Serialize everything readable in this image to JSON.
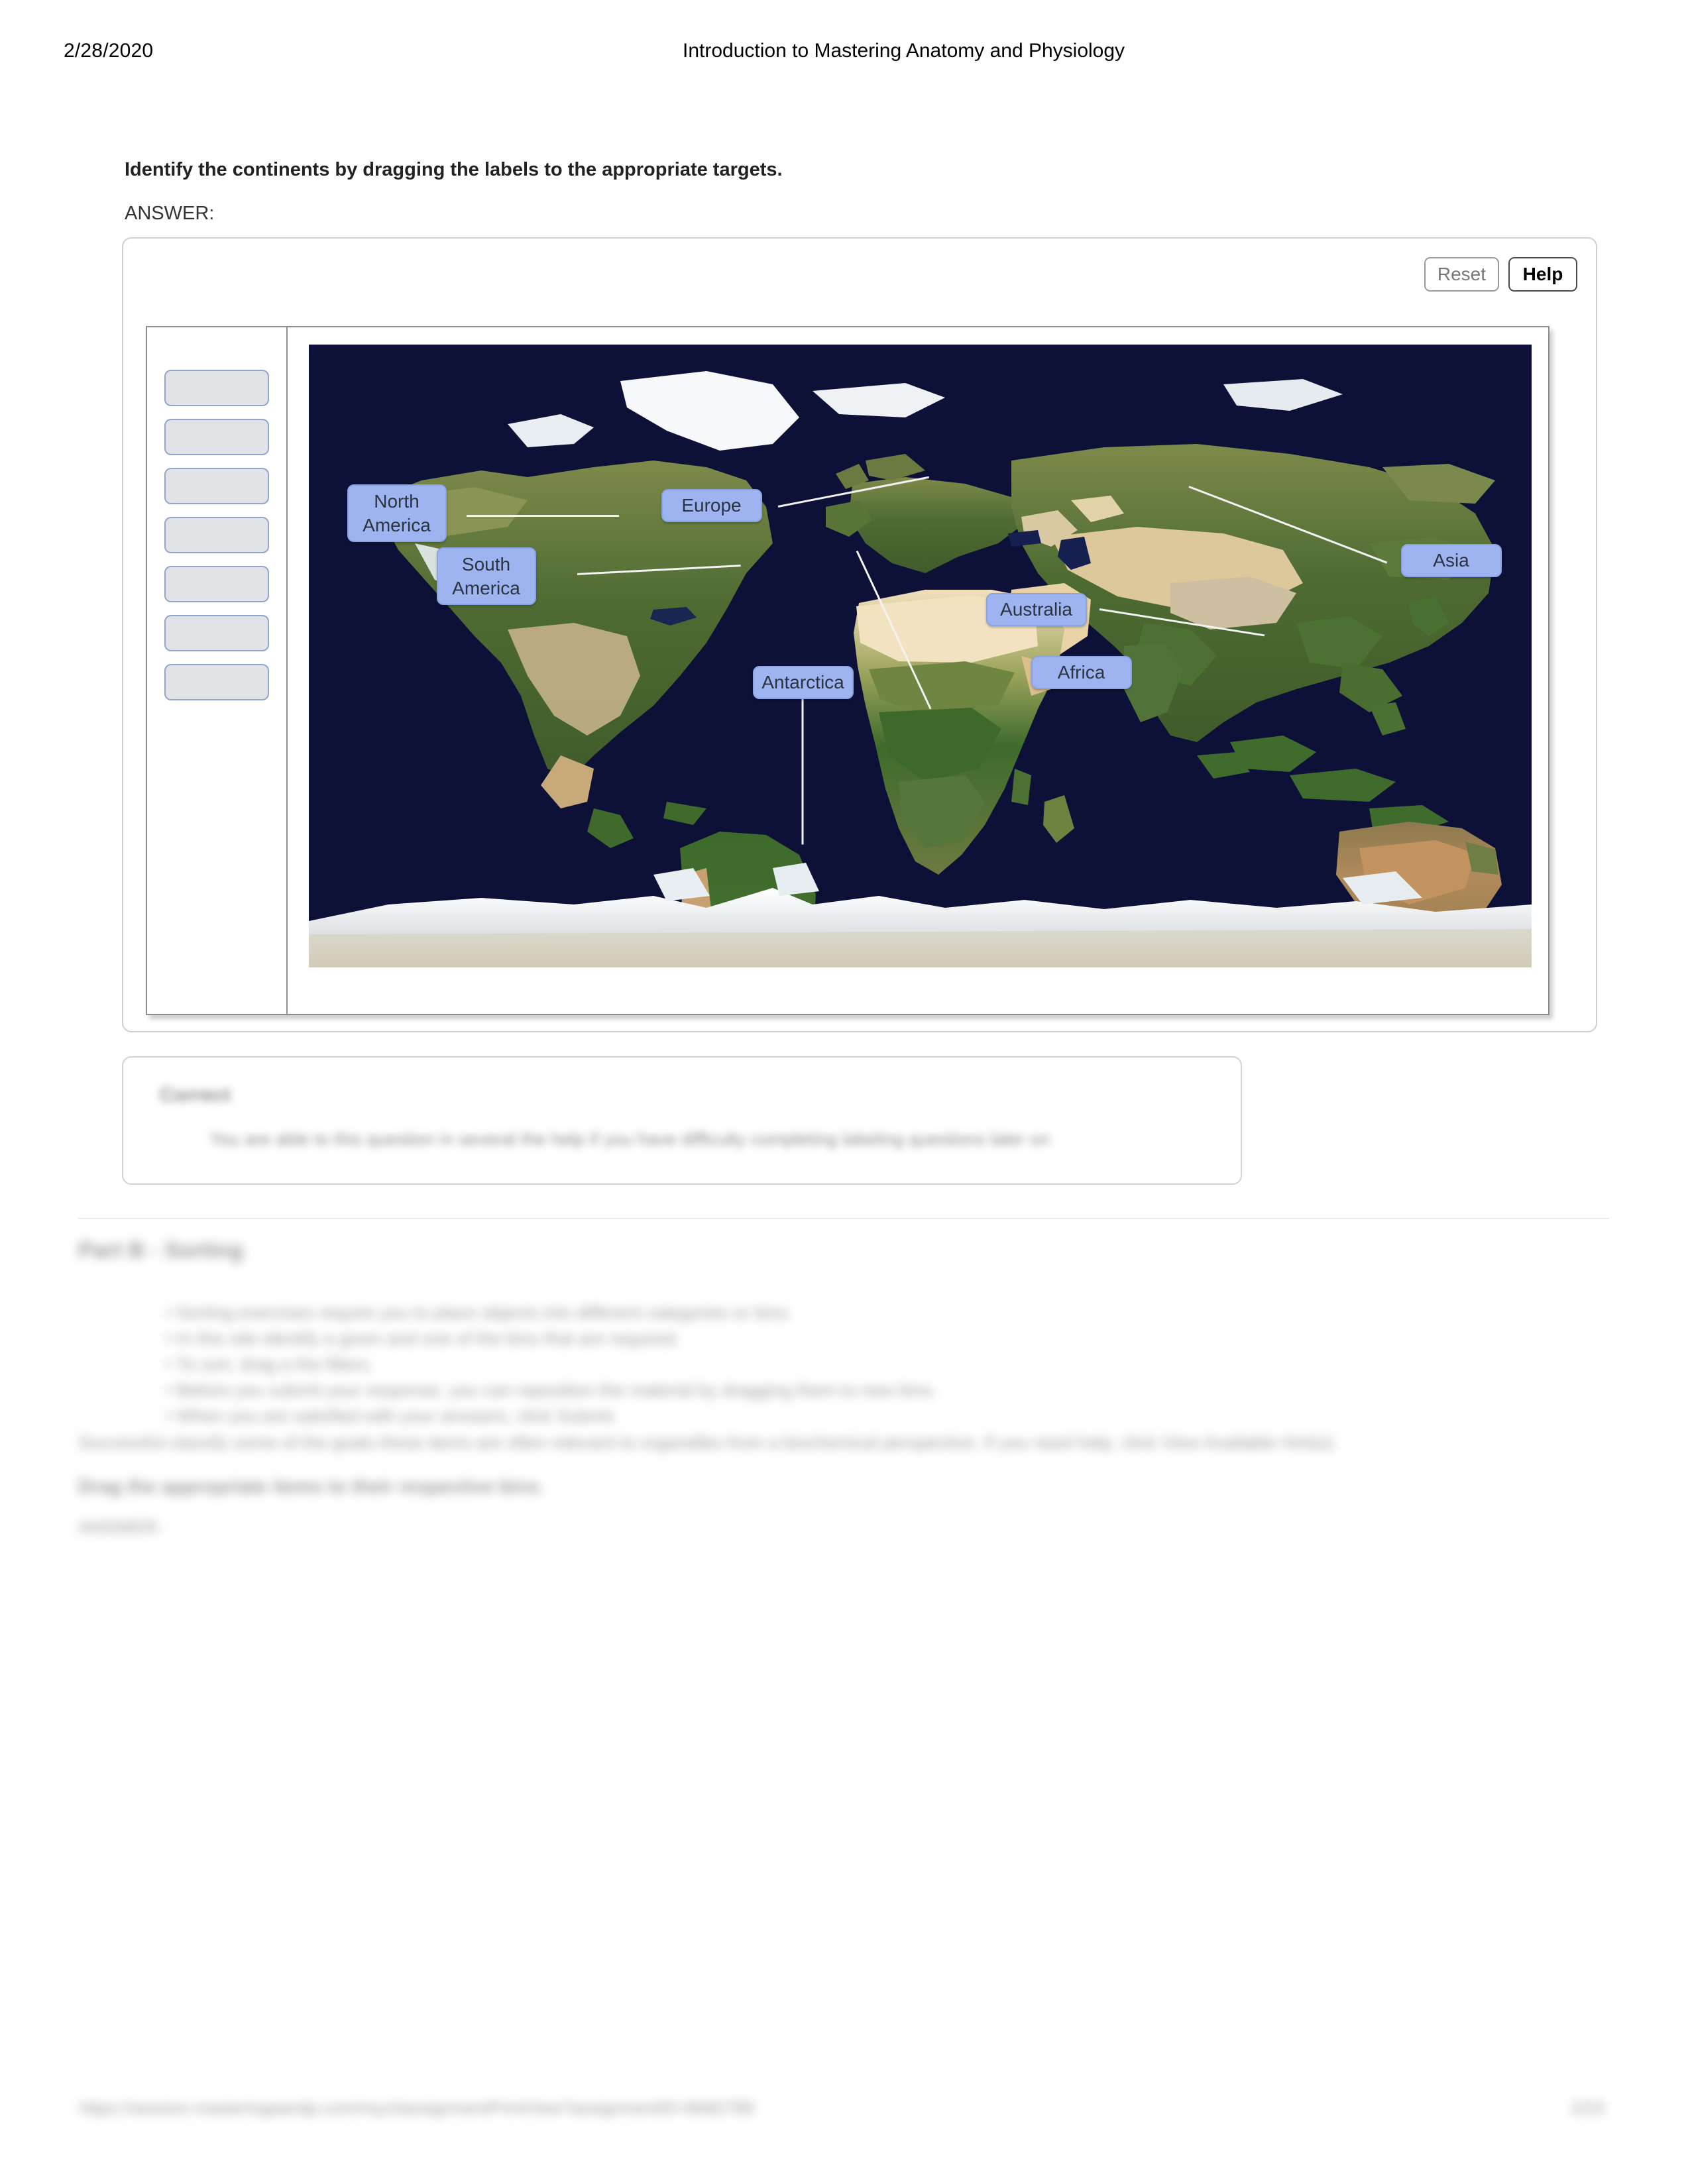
{
  "header": {
    "date": "2/28/2020",
    "title": "Introduction to Mastering Anatomy and Physiology"
  },
  "question": {
    "prompt": "Identify the continents by dragging the labels to the appropriate targets.",
    "answer_label": "ANSWER:"
  },
  "toolbar": {
    "reset_label": "Reset",
    "help_label": "Help"
  },
  "bank": {
    "slot_count": 7,
    "slots": [
      "",
      "",
      "",
      "",
      "",
      "",
      ""
    ]
  },
  "map": {
    "ocean_color": "#0d1138",
    "label_fill": "#9db4f0",
    "label_border": "#8aa4e4",
    "label_text_color": "#2d3340",
    "leader_color": "#f2f2f2",
    "labels": [
      {
        "name": "North America",
        "lines": [
          "North",
          "America"
        ]
      },
      {
        "name": "Europe",
        "lines": [
          "Europe"
        ]
      },
      {
        "name": "Asia",
        "lines": [
          "Asia"
        ]
      },
      {
        "name": "South America",
        "lines": [
          "South",
          "America"
        ]
      },
      {
        "name": "Australia",
        "lines": [
          "Australia"
        ]
      },
      {
        "name": "Africa",
        "lines": [
          "Africa"
        ]
      },
      {
        "name": "Antarctica",
        "lines": [
          "Antarctica"
        ]
      }
    ]
  },
  "feedback": {
    "title": "Correct",
    "body": "You are able to this question in several the help if you have difficulty completing labeling questions later on"
  },
  "lower": {
    "section_title": "Part B - Sorting",
    "bullets": [
      "Sorting exercises require you to place objects into different categories or bins.",
      "In this site identify a given and one of the bins that are required.",
      "To sort, drag a the filters.",
      "Before you submit your response, you can reposition the material by dragging them to new bins.",
      "When you are satisfied with your answers, click Submit."
    ],
    "paragraph": "Successful classify some of the goals these items are often relevant to organelles from a biochemical perspective. If you need help, click View Available Hint(s)",
    "sub_instruction": "Drag the appropriate items to their respective bins.",
    "sub_answer": "ANSWER:"
  },
  "footer": {
    "left": "https://session.masteringaandp.com/myct/assignmentPrintView?assignmentID=8082789",
    "right": "2/23"
  }
}
